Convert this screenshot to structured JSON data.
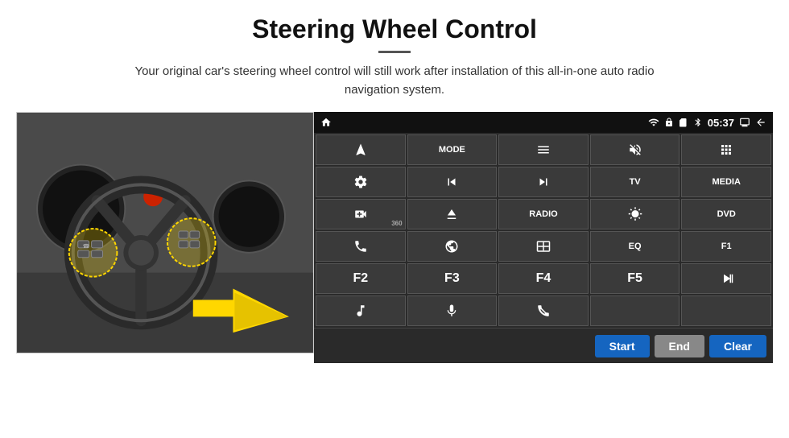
{
  "header": {
    "title": "Steering Wheel Control",
    "subtitle": "Your original car's steering wheel control will still work after installation of this all-in-one auto radio navigation system."
  },
  "status_bar": {
    "time": "05:37",
    "icons": [
      "wifi",
      "lock",
      "sim",
      "bluetooth",
      "screen",
      "back"
    ]
  },
  "buttons": [
    {
      "id": "nav",
      "label": "",
      "icon": "nav"
    },
    {
      "id": "mode",
      "label": "MODE",
      "icon": ""
    },
    {
      "id": "menu",
      "label": "",
      "icon": "list"
    },
    {
      "id": "mute",
      "label": "",
      "icon": "mute"
    },
    {
      "id": "apps",
      "label": "",
      "icon": "apps"
    },
    {
      "id": "settings",
      "label": "",
      "icon": "gear"
    },
    {
      "id": "prev",
      "label": "",
      "icon": "prev"
    },
    {
      "id": "next",
      "label": "",
      "icon": "next"
    },
    {
      "id": "tv",
      "label": "TV",
      "icon": ""
    },
    {
      "id": "media",
      "label": "MEDIA",
      "icon": ""
    },
    {
      "id": "cam360",
      "label": "",
      "icon": "360cam"
    },
    {
      "id": "eject",
      "label": "",
      "icon": "eject"
    },
    {
      "id": "radio",
      "label": "RADIO",
      "icon": ""
    },
    {
      "id": "brightness",
      "label": "",
      "icon": "brightness"
    },
    {
      "id": "dvd",
      "label": "DVD",
      "icon": ""
    },
    {
      "id": "phone",
      "label": "",
      "icon": "phone"
    },
    {
      "id": "web",
      "label": "",
      "icon": "web"
    },
    {
      "id": "window",
      "label": "",
      "icon": "window"
    },
    {
      "id": "eq",
      "label": "EQ",
      "icon": ""
    },
    {
      "id": "f1",
      "label": "F1",
      "icon": ""
    },
    {
      "id": "f2",
      "label": "F2",
      "icon": ""
    },
    {
      "id": "f3",
      "label": "F3",
      "icon": ""
    },
    {
      "id": "f4",
      "label": "F4",
      "icon": ""
    },
    {
      "id": "f5",
      "label": "F5",
      "icon": ""
    },
    {
      "id": "playpause",
      "label": "",
      "icon": "playpause"
    },
    {
      "id": "music",
      "label": "",
      "icon": "music"
    },
    {
      "id": "mic",
      "label": "",
      "icon": "mic"
    },
    {
      "id": "call",
      "label": "",
      "icon": "callend"
    },
    {
      "id": "empty1",
      "label": "",
      "icon": ""
    },
    {
      "id": "empty2",
      "label": "",
      "icon": ""
    }
  ],
  "action_bar": {
    "start_label": "Start",
    "end_label": "End",
    "clear_label": "Clear"
  }
}
